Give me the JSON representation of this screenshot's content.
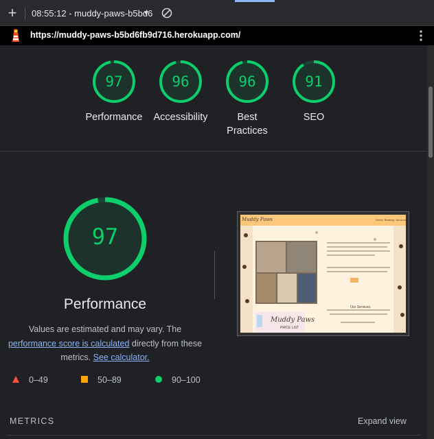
{
  "devtools": {
    "session_label": "08:55:12 - muddy-paws-b5bd6",
    "new_label": "+",
    "accent_color": "#8ab4f8"
  },
  "url_bar": {
    "url": "https://muddy-paws-b5bd6fb9d716.herokuapp.com/"
  },
  "categories": [
    {
      "label": "Performance",
      "score": 97
    },
    {
      "label": "Accessibility",
      "score": 96
    },
    {
      "label": "Best Practices",
      "score": 96
    },
    {
      "label": "SEO",
      "score": 91
    }
  ],
  "main": {
    "score": 97,
    "title": "Performance",
    "desc_prefix": "Values are estimated and may vary. The ",
    "desc_link": "performance score is calculated",
    "desc_middle": " directly from these metrics. ",
    "desc_link2": "See calculator."
  },
  "screenshot": {
    "logo": "Muddy Paws",
    "nav_items": [
      "Home",
      "Booking",
      "Account"
    ],
    "card_title": "Muddy Paws",
    "card_sub": "PRICE LIST",
    "services_heading": "Our Services:"
  },
  "legend": [
    {
      "label": "0–49",
      "color": "#ff4e42",
      "shape": "triangle"
    },
    {
      "label": "50–89",
      "color": "#ffa400",
      "shape": "square"
    },
    {
      "label": "90–100",
      "color": "#0cce6b",
      "shape": "circle"
    }
  ],
  "metrics": {
    "heading": "METRICS",
    "expand_label": "Expand view"
  },
  "colors": {
    "pass": "#0cce6b",
    "background": "#202124"
  }
}
